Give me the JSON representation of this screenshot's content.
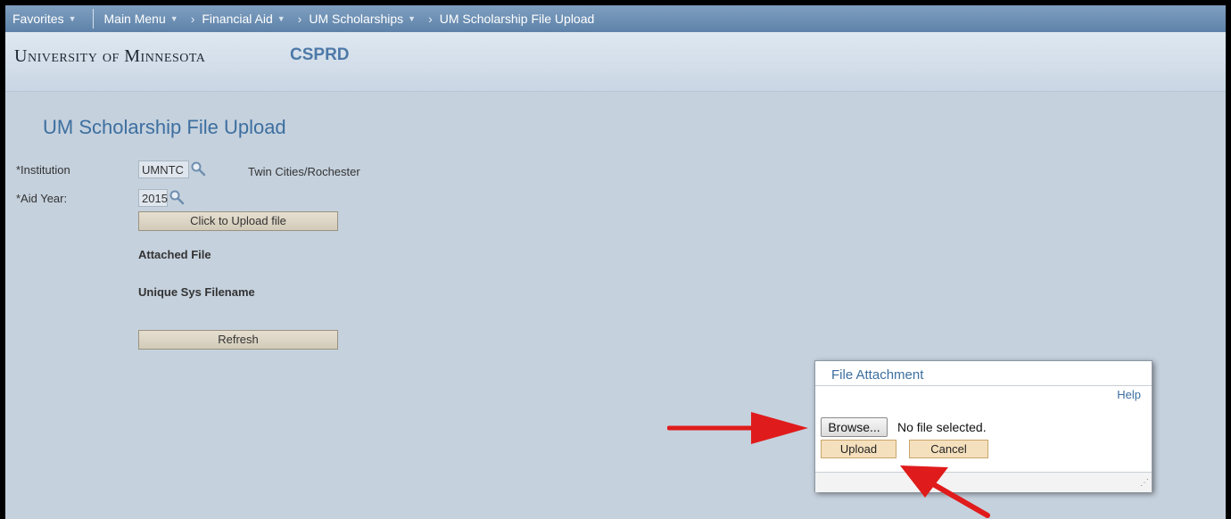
{
  "nav": {
    "favorites": "Favorites",
    "items": [
      "Main Menu",
      "Financial Aid",
      "UM Scholarships",
      "UM Scholarship File Upload"
    ]
  },
  "header": {
    "university_first": "U",
    "university_rest": "niversity of ",
    "university_m": "M",
    "university_end": "innesota",
    "environment": "CSPRD"
  },
  "page": {
    "title": "UM Scholarship File Upload",
    "institution_label": "*Institution",
    "institution_value": "UMNTC",
    "institution_desc": "Twin Cities/Rochester",
    "aid_year_label": "*Aid Year:",
    "aid_year_value": "2015",
    "upload_button": "Click to Upload file",
    "attached_file_label": "Attached File",
    "unique_filename_label": "Unique Sys Filename",
    "refresh_button": "Refresh"
  },
  "dialog": {
    "title": "File Attachment",
    "help": "Help",
    "browse": "Browse...",
    "no_file": "No file selected.",
    "upload": "Upload",
    "cancel": "Cancel"
  },
  "colors": {
    "nav_bar": "#6f92b6",
    "title_blue": "#3d6fa0",
    "arrow_red": "#e01b1b"
  }
}
